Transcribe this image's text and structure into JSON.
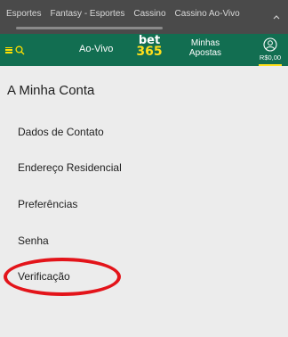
{
  "topnav": {
    "tabs": [
      "Esportes",
      "Fantasy - Esportes",
      "Cassino",
      "Cassino Ao-Vivo"
    ]
  },
  "header": {
    "ao_vivo": "Ao-Vivo",
    "logo_top": "bet",
    "logo_bottom": "365",
    "apostas_line1": "Minhas",
    "apostas_line2": "Apostas",
    "balance": "R$0,00",
    "accent_color": "#ffdf1b",
    "header_color": "#126e51"
  },
  "page": {
    "title": "A Minha Conta",
    "items": [
      "Dados de Contato",
      "Endereço Residencial",
      "Preferências",
      "Senha",
      "Verificação"
    ],
    "highlight_color": "#e3141a"
  }
}
